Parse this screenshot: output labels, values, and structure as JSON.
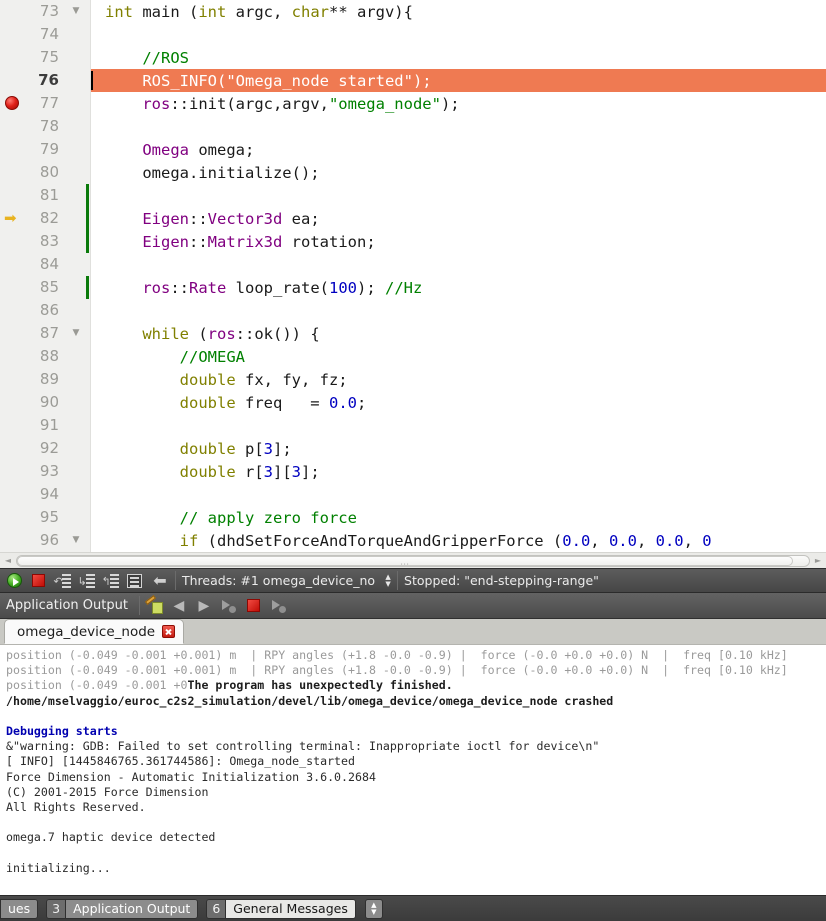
{
  "editor": {
    "first_line": 73,
    "highlight_line": 76,
    "breakpoint_line": 77,
    "instruction_pointer_line": 82,
    "fold_lines": [
      73,
      87,
      96
    ],
    "changed_lines": [
      81,
      82,
      83,
      85
    ],
    "colors": {
      "highlight_bg": "#ef7a52",
      "keyword": "#808000",
      "type": "#800080",
      "number": "#0000c0",
      "string": "#008000",
      "comment": "#008000",
      "change_marker": "#0a7a0a",
      "breakpoint": "#e02018"
    },
    "lines": [
      {
        "n": "73",
        "tokens": [
          {
            "t": "int ",
            "c": "kw"
          },
          {
            "t": "main (",
            "c": "pln"
          },
          {
            "t": "int",
            "c": "kw"
          },
          {
            "t": " argc, ",
            "c": "pln"
          },
          {
            "t": "char",
            "c": "kw"
          },
          {
            "t": "** argv){",
            "c": "pln"
          }
        ]
      },
      {
        "n": "74",
        "tokens": []
      },
      {
        "n": "75",
        "tokens": [
          {
            "t": "    ",
            "c": "pln"
          },
          {
            "t": "//ROS",
            "c": "cmt"
          }
        ]
      },
      {
        "n": "76",
        "tokens": [
          {
            "t": "    ROS_INFO(",
            "c": "pln"
          },
          {
            "t": "\"Omega_node started\"",
            "c": "str"
          },
          {
            "t": ");",
            "c": "pln"
          }
        ]
      },
      {
        "n": "77",
        "tokens": [
          {
            "t": "    ",
            "c": "pln"
          },
          {
            "t": "ros",
            "c": "typ"
          },
          {
            "t": "::init(argc,argv,",
            "c": "pln"
          },
          {
            "t": "\"omega_node\"",
            "c": "str"
          },
          {
            "t": ");",
            "c": "pln"
          }
        ]
      },
      {
        "n": "78",
        "tokens": []
      },
      {
        "n": "79",
        "tokens": [
          {
            "t": "    ",
            "c": "pln"
          },
          {
            "t": "Omega",
            "c": "typ"
          },
          {
            "t": " omega;",
            "c": "pln"
          }
        ]
      },
      {
        "n": "80",
        "tokens": [
          {
            "t": "    omega.initialize();",
            "c": "pln"
          }
        ]
      },
      {
        "n": "81",
        "tokens": []
      },
      {
        "n": "82",
        "tokens": [
          {
            "t": "    ",
            "c": "pln"
          },
          {
            "t": "Eigen",
            "c": "typ"
          },
          {
            "t": "::",
            "c": "pln"
          },
          {
            "t": "Vector3d",
            "c": "typ"
          },
          {
            "t": " ea;",
            "c": "pln"
          }
        ]
      },
      {
        "n": "83",
        "tokens": [
          {
            "t": "    ",
            "c": "pln"
          },
          {
            "t": "Eigen",
            "c": "typ"
          },
          {
            "t": "::",
            "c": "pln"
          },
          {
            "t": "Matrix3d",
            "c": "typ"
          },
          {
            "t": " rotation;",
            "c": "pln"
          }
        ]
      },
      {
        "n": "84",
        "tokens": []
      },
      {
        "n": "85",
        "tokens": [
          {
            "t": "    ",
            "c": "pln"
          },
          {
            "t": "ros",
            "c": "typ"
          },
          {
            "t": "::",
            "c": "pln"
          },
          {
            "t": "Rate",
            "c": "typ"
          },
          {
            "t": " loop_rate(",
            "c": "pln"
          },
          {
            "t": "100",
            "c": "num"
          },
          {
            "t": "); ",
            "c": "pln"
          },
          {
            "t": "//Hz",
            "c": "cmt"
          }
        ]
      },
      {
        "n": "86",
        "tokens": []
      },
      {
        "n": "87",
        "tokens": [
          {
            "t": "    ",
            "c": "pln"
          },
          {
            "t": "while",
            "c": "kw"
          },
          {
            "t": " (",
            "c": "pln"
          },
          {
            "t": "ros",
            "c": "typ"
          },
          {
            "t": "::ok()) {",
            "c": "pln"
          }
        ]
      },
      {
        "n": "88",
        "tokens": [
          {
            "t": "        ",
            "c": "pln"
          },
          {
            "t": "//OMEGA",
            "c": "cmt"
          }
        ]
      },
      {
        "n": "89",
        "tokens": [
          {
            "t": "        ",
            "c": "pln"
          },
          {
            "t": "double",
            "c": "kw"
          },
          {
            "t": " fx, fy, fz;",
            "c": "pln"
          }
        ]
      },
      {
        "n": "90",
        "tokens": [
          {
            "t": "        ",
            "c": "pln"
          },
          {
            "t": "double",
            "c": "kw"
          },
          {
            "t": " freq   = ",
            "c": "pln"
          },
          {
            "t": "0.0",
            "c": "num"
          },
          {
            "t": ";",
            "c": "pln"
          }
        ]
      },
      {
        "n": "91",
        "tokens": []
      },
      {
        "n": "92",
        "tokens": [
          {
            "t": "        ",
            "c": "pln"
          },
          {
            "t": "double",
            "c": "kw"
          },
          {
            "t": " p[",
            "c": "pln"
          },
          {
            "t": "3",
            "c": "num"
          },
          {
            "t": "];",
            "c": "pln"
          }
        ]
      },
      {
        "n": "93",
        "tokens": [
          {
            "t": "        ",
            "c": "pln"
          },
          {
            "t": "double",
            "c": "kw"
          },
          {
            "t": " r[",
            "c": "pln"
          },
          {
            "t": "3",
            "c": "num"
          },
          {
            "t": "][",
            "c": "pln"
          },
          {
            "t": "3",
            "c": "num"
          },
          {
            "t": "];",
            "c": "pln"
          }
        ]
      },
      {
        "n": "94",
        "tokens": []
      },
      {
        "n": "95",
        "tokens": [
          {
            "t": "        ",
            "c": "pln"
          },
          {
            "t": "// apply zero force",
            "c": "cmt"
          }
        ]
      },
      {
        "n": "96",
        "tokens": [
          {
            "t": "        ",
            "c": "pln"
          },
          {
            "t": "if",
            "c": "kw"
          },
          {
            "t": " (dhdSetForceAndTorqueAndGripperForce (",
            "c": "pln"
          },
          {
            "t": "0.0",
            "c": "num"
          },
          {
            "t": ", ",
            "c": "pln"
          },
          {
            "t": "0.0",
            "c": "num"
          },
          {
            "t": ", ",
            "c": "pln"
          },
          {
            "t": "0.0",
            "c": "num"
          },
          {
            "t": ", ",
            "c": "pln"
          },
          {
            "t": "0",
            "c": "num"
          }
        ]
      }
    ]
  },
  "debug_toolbar": {
    "buttons": [
      {
        "name": "continue",
        "icon": "continue-icon"
      },
      {
        "name": "stop",
        "icon": "stop-icon"
      },
      {
        "name": "step-over",
        "icon": "step-over-icon"
      },
      {
        "name": "step-into",
        "icon": "step-into-icon"
      },
      {
        "name": "step-out",
        "icon": "step-out-icon"
      },
      {
        "name": "instruction-view",
        "icon": "instruction-list-icon"
      },
      {
        "name": "step-back",
        "icon": "back-arrow-icon"
      }
    ],
    "threads_label": "Threads: #1 omega_device_no",
    "status_label": "Stopped: \"end-stepping-range\""
  },
  "app_output": {
    "title": "Application Output",
    "buttons": [
      {
        "name": "clean-pane",
        "icon": "clean-icon"
      },
      {
        "name": "prev-item",
        "icon": "arrow-left-icon"
      },
      {
        "name": "next-item",
        "icon": "arrow-right-icon"
      },
      {
        "name": "run-disabled",
        "icon": "run-icon"
      },
      {
        "name": "stop",
        "icon": "stop-icon"
      },
      {
        "name": "rerun-disabled",
        "icon": "rerun-icon"
      }
    ],
    "tab": {
      "label": "omega_device_node",
      "close_icon": "close-icon"
    }
  },
  "console": {
    "lines": [
      {
        "type": "mixed",
        "segments": [
          {
            "text": "position (-0.049 -0.001 +0.001) m  | RPY angles (+1.8 -0.0 -0.9) |  force (-0.0 +0.0 +0.0) N  |  freq [0.10 kHz]",
            "style": "gray"
          }
        ]
      },
      {
        "type": "mixed",
        "segments": [
          {
            "text": "position (-0.049 -0.001 +0.001) m  | RPY angles (+1.8 -0.0 -0.9) |  force (-0.0 +0.0 +0.0) N  |  freq [0.10 kHz]",
            "style": "gray"
          }
        ]
      },
      {
        "type": "mixed",
        "segments": [
          {
            "text": "position (-0.049 -0.001 +0",
            "style": "gray"
          },
          {
            "text": "The program has unexpectedly finished.",
            "style": "black"
          }
        ]
      },
      {
        "type": "mixed",
        "segments": [
          {
            "text": "/home/mselvaggio/euroc_c2s2_simulation/devel/lib/omega_device/omega_device_node crashed",
            "style": "black"
          }
        ]
      },
      {
        "type": "blank"
      },
      {
        "type": "mixed",
        "segments": [
          {
            "text": "Debugging starts",
            "style": "blue"
          }
        ]
      },
      {
        "type": "mixed",
        "segments": [
          {
            "text": "&\"warning: GDB: Failed to set controlling terminal: Inappropriate ioctl for device\\n\"",
            "style": "norm"
          }
        ]
      },
      {
        "type": "mixed",
        "segments": [
          {
            "text": "[ INFO] [1445846765.361744586]: Omega_node_started",
            "style": "norm"
          }
        ]
      },
      {
        "type": "mixed",
        "segments": [
          {
            "text": "Force Dimension - Automatic Initialization 3.6.0.2684",
            "style": "norm"
          }
        ]
      },
      {
        "type": "mixed",
        "segments": [
          {
            "text": "(C) 2001-2015 Force Dimension",
            "style": "norm"
          }
        ]
      },
      {
        "type": "mixed",
        "segments": [
          {
            "text": "All Rights Reserved.",
            "style": "norm"
          }
        ]
      },
      {
        "type": "blank"
      },
      {
        "type": "mixed",
        "segments": [
          {
            "text": "omega.7 haptic device detected",
            "style": "norm"
          }
        ]
      },
      {
        "type": "blank"
      },
      {
        "type": "mixed",
        "segments": [
          {
            "text": "initializing...",
            "style": "norm"
          }
        ]
      }
    ]
  },
  "statusbar": {
    "items": [
      {
        "num": "",
        "label": "ues",
        "active": false,
        "partial": true
      },
      {
        "num": "3",
        "label": "Application Output",
        "active": false,
        "partial": false
      },
      {
        "num": "6",
        "label": "General Messages",
        "active": true,
        "partial": false
      }
    ],
    "spinner_icon": "updown-spinner-icon"
  }
}
